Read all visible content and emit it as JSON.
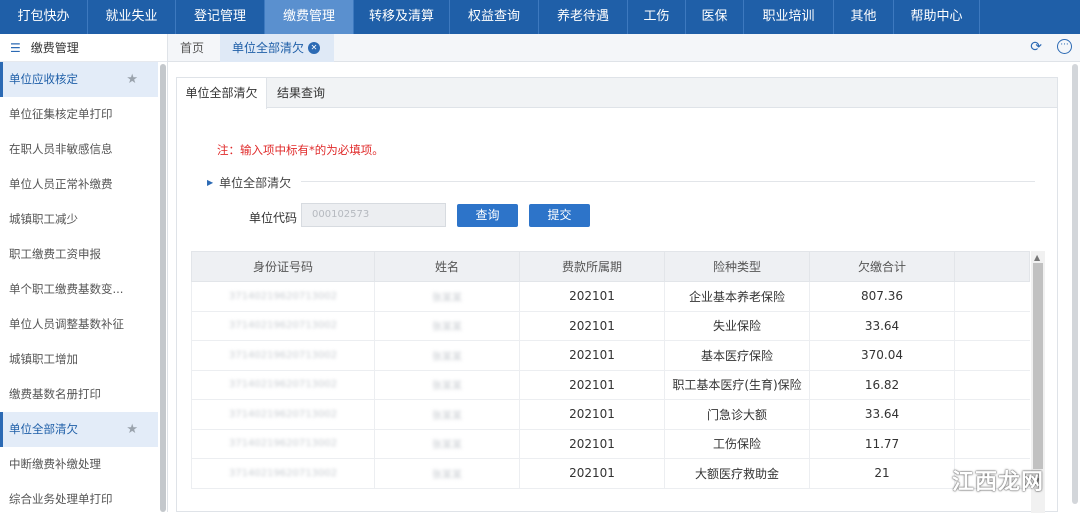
{
  "nav": {
    "items": [
      {
        "label": "打包快办",
        "active": false
      },
      {
        "label": "就业失业",
        "active": false
      },
      {
        "label": "登记管理",
        "active": false
      },
      {
        "label": "缴费管理",
        "active": true
      },
      {
        "label": "转移及清算",
        "active": false
      },
      {
        "label": "权益查询",
        "active": false
      },
      {
        "label": "养老待遇",
        "active": false
      },
      {
        "label": "工伤",
        "active": false
      },
      {
        "label": "医保",
        "active": false
      },
      {
        "label": "职业培训",
        "active": false
      },
      {
        "label": "其他",
        "active": false
      },
      {
        "label": "帮助中心",
        "active": false
      }
    ]
  },
  "sidebar": {
    "title": "缴费管理",
    "items": [
      {
        "label": "单位应收核定",
        "active": true
      },
      {
        "label": "单位征集核定单打印"
      },
      {
        "label": "在职人员非敏感信息"
      },
      {
        "label": "单位人员正常补缴费"
      },
      {
        "label": "城镇职工减少"
      },
      {
        "label": "职工缴费工资申报"
      },
      {
        "label": "单个职工缴费基数变..."
      },
      {
        "label": "单位人员调整基数补征"
      },
      {
        "label": "城镇职工增加"
      },
      {
        "label": "缴费基数名册打印"
      },
      {
        "label": "单位全部清欠",
        "active": true
      },
      {
        "label": "中断缴费补缴处理"
      },
      {
        "label": "综合业务处理单打印"
      }
    ]
  },
  "tabs": {
    "home": "首页",
    "current": "单位全部清欠"
  },
  "panel": {
    "tab_active": "单位全部清欠",
    "tab_other": "结果查询",
    "note": "注：输入项中标有*的为必填项。",
    "section_title": "单位全部清欠",
    "field_label": "单位代码",
    "field_value": "000102573",
    "query_button": "查询",
    "submit_button": "提交"
  },
  "table": {
    "headers": [
      "身份证号码",
      "姓名",
      "费款所属期",
      "险种类型",
      "欠缴合计"
    ],
    "rows": [
      {
        "id": "37140219620713002",
        "name": "张某某",
        "period": "202101",
        "type": "企业基本养老保险",
        "amount": "807.36"
      },
      {
        "id": "37140219620713002",
        "name": "张某某",
        "period": "202101",
        "type": "失业保险",
        "amount": "33.64"
      },
      {
        "id": "37140219620713002",
        "name": "张某某",
        "period": "202101",
        "type": "基本医疗保险",
        "amount": "370.04"
      },
      {
        "id": "37140219620713002",
        "name": "张某某",
        "period": "202101",
        "type": "职工基本医疗(生育)保险",
        "amount": "16.82"
      },
      {
        "id": "37140219620713002",
        "name": "张某某",
        "period": "202101",
        "type": "门急诊大额",
        "amount": "33.64"
      },
      {
        "id": "37140219620713002",
        "name": "张某某",
        "period": "202101",
        "type": "工伤保险",
        "amount": "11.77"
      },
      {
        "id": "37140219620713002",
        "name": "张某某",
        "period": "202101",
        "type": "大额医疗救助金",
        "amount": "21"
      }
    ]
  },
  "watermark": "江西龙网",
  "colors": {
    "nav_bg": "#1f5fa8",
    "nav_active": "#5a90cf",
    "accent": "#2d74c9",
    "note": "#e02b2b"
  }
}
